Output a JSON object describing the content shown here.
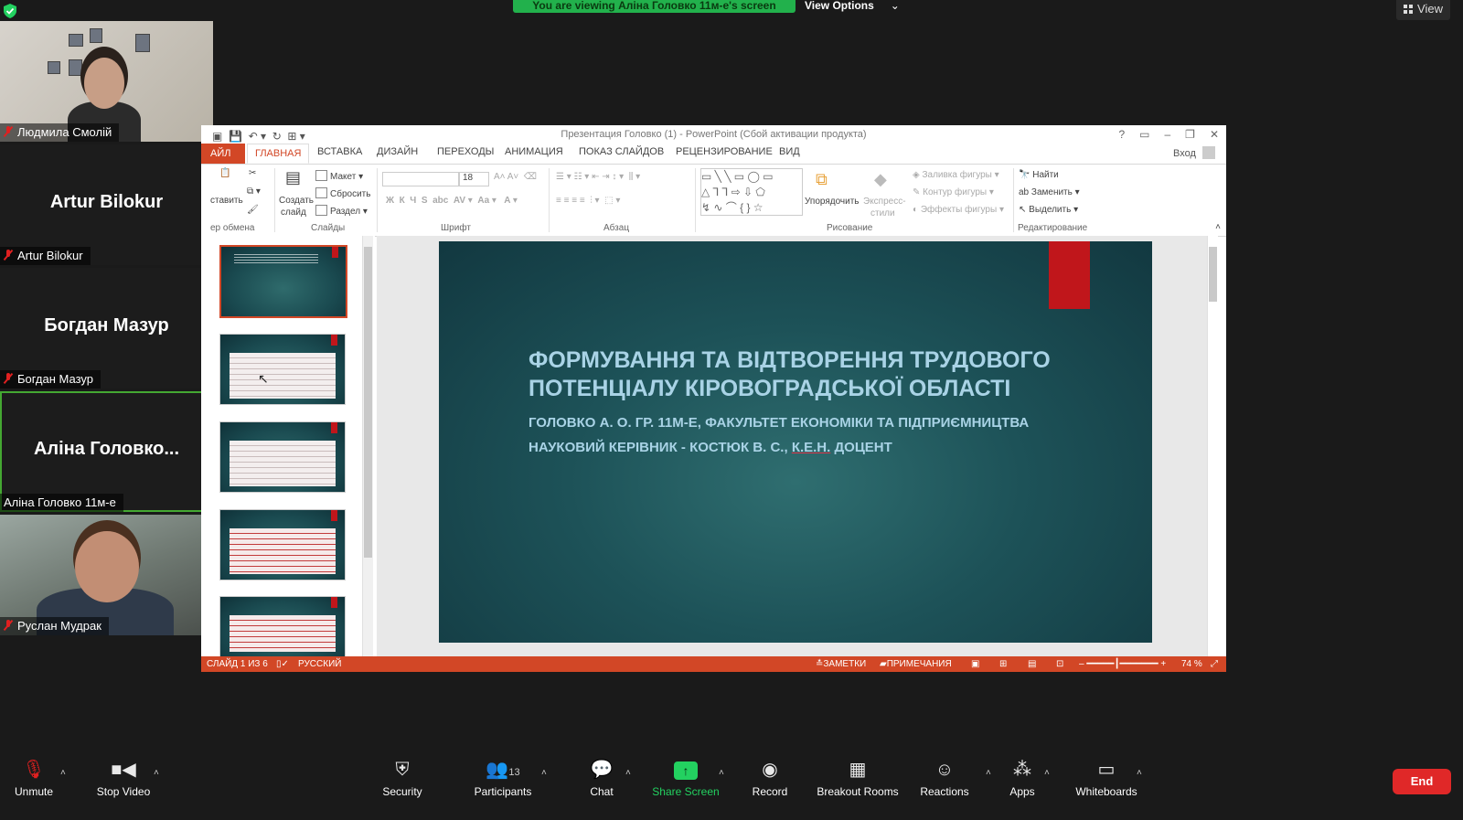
{
  "banner": {
    "text": "You are viewing Аліна Головко 11м-е's screen",
    "view_options": "View Options",
    "view_options_chevron": "⌄"
  },
  "view_button": "View",
  "participants": [
    {
      "name": "Людмила Смолій",
      "video": true
    },
    {
      "name": "Artur Bilokur",
      "display": "Artur Bilokur"
    },
    {
      "name": "Богдан Мазур",
      "display": "Богдан Мазур"
    },
    {
      "name": "Аліна Головко 11м-е",
      "display": "Аліна Головко..."
    },
    {
      "name": "Руслан Мудрак",
      "video": true
    }
  ],
  "ppt": {
    "window_title": "Презентация Головко (1) - PowerPoint (Сбой активации продукта)",
    "login": "Вход",
    "tabs": [
      "АЙЛ",
      "ГЛАВНАЯ",
      "ВСТАВКА",
      "ДИЗАЙН",
      "ПЕРЕХОДЫ",
      "АНИМАЦИЯ",
      "ПОКАЗ СЛАЙДОВ",
      "РЕЦЕНЗИРОВАНИЕ",
      "ВИД"
    ],
    "ribbon": {
      "paste": "ставить",
      "clipboard_group": "ер обмена",
      "create_slide": "Создать",
      "create_slide2": "слайд",
      "layout": "Макет",
      "reset": "Сбросить",
      "section": "Раздел",
      "slides_group": "Слайды",
      "font_size": "18",
      "font_group": "Шрифт",
      "paragraph_group": "Абзац",
      "arrange": "Упорядочить",
      "quick_styles": "Экспресс-",
      "quick_styles2": "стили",
      "shape_fill": "Заливка фигуры",
      "shape_outline": "Контур фигуры",
      "shape_effects": "Эффекты фигуры",
      "drawing_group": "Рисование",
      "find": "Найти",
      "replace": "Заменить",
      "select": "Выделить",
      "editing_group": "Редактирование"
    },
    "slide": {
      "title_line1": "ФОРМУВАННЯ ТА ВІДТВОРЕННЯ ТРУДОВОГО",
      "title_line2": "ПОТЕНЦІАЛУ КІРОВОГРАДСЬКОЇ ОБЛАСТІ",
      "subtitle_line1": "ГОЛОВКО А. О. ГР. 11М-Е, ФАКУЛЬТЕТ ЕКОНОМІКИ ТА ПІДПРИЄМНИЦТВА",
      "subtitle_line2_a": "НАУКОВИЙ КЕРІВНИК - КОСТЮК В. С., ",
      "subtitle_line2_b": "К.Е.Н.",
      "subtitle_line2_c": " ДОЦЕНТ"
    },
    "status": {
      "slide": "СЛАЙД 1 ИЗ 6",
      "language": "РУССКИЙ",
      "notes": "ЗАМЕТКИ",
      "comments": "ПРИМЕЧАНИЯ",
      "zoom": "74 %"
    }
  },
  "toolbar": {
    "unmute": "Unmute",
    "stop_video": "Stop Video",
    "security": "Security",
    "participants": "Participants",
    "participants_count": "13",
    "chat": "Chat",
    "share_screen": "Share Screen",
    "record": "Record",
    "breakout": "Breakout Rooms",
    "reactions": "Reactions",
    "apps": "Apps",
    "whiteboards": "Whiteboards",
    "end": "End"
  },
  "colors": {
    "zoom_green": "#23d160",
    "ppt_accent": "#d24726",
    "end_red": "#e02828"
  }
}
